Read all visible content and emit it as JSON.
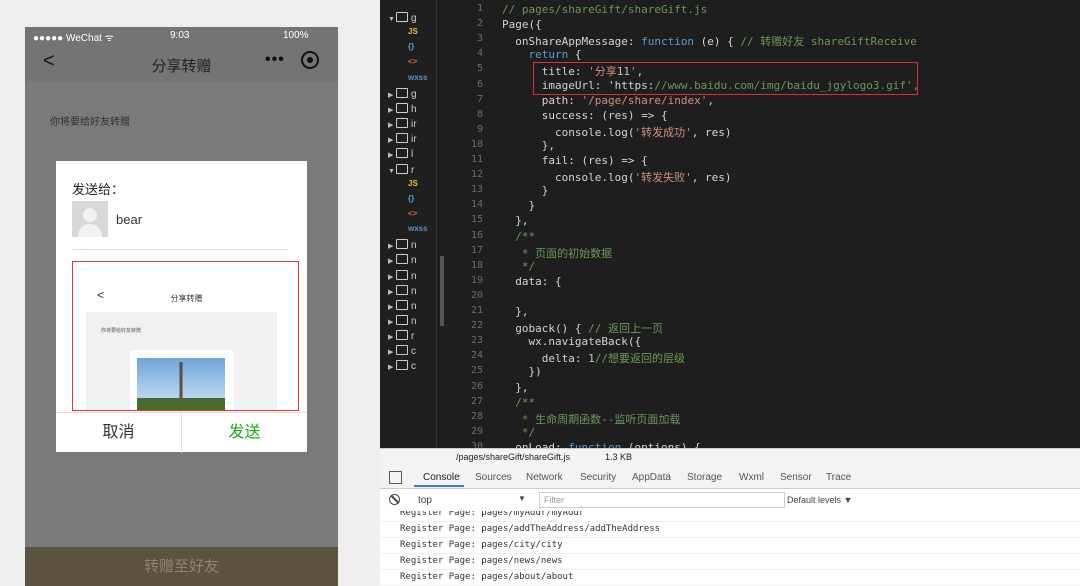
{
  "simulator": {
    "status": {
      "carrier": "●●●●● WeChat ᯤ",
      "time": "9:03",
      "battery": "100%"
    },
    "nav": {
      "back": "<",
      "title": "分享转赠",
      "more": "•••"
    },
    "page_hint": "你将要给好友转赠",
    "bottom_button": "转赠至好友",
    "dialog": {
      "title": "发送给：",
      "user": "bear",
      "preview": {
        "back": "<",
        "title": "分享转赠",
        "hint": "你将要给好友转赠"
      },
      "cancel": "取消",
      "send": "发送"
    }
  },
  "sidebar": {
    "items": [
      {
        "label": "g",
        "type": "folder-open"
      },
      {
        "label": "JS",
        "type": "file-js"
      },
      {
        "label": "{}",
        "type": "file-json"
      },
      {
        "label": "<>",
        "type": "file-wxml"
      },
      {
        "label": "wxss",
        "type": "file-wxss"
      },
      {
        "label": "g",
        "type": "folder"
      },
      {
        "label": "h",
        "type": "folder"
      },
      {
        "label": "ir",
        "type": "folder"
      },
      {
        "label": "ir",
        "type": "folder"
      },
      {
        "label": "l",
        "type": "folder"
      },
      {
        "label": "r",
        "type": "folder-open"
      },
      {
        "label": "JS",
        "type": "file-js"
      },
      {
        "label": "{}",
        "type": "file-json"
      },
      {
        "label": "<>",
        "type": "file-wxml"
      },
      {
        "label": "wxss",
        "type": "file-wxss"
      },
      {
        "label": "n",
        "type": "folder"
      },
      {
        "label": "n",
        "type": "folder"
      },
      {
        "label": "n",
        "type": "folder"
      },
      {
        "label": "n",
        "type": "folder"
      },
      {
        "label": "n",
        "type": "folder"
      },
      {
        "label": "n",
        "type": "folder"
      },
      {
        "label": "r",
        "type": "folder"
      },
      {
        "label": "c",
        "type": "folder"
      },
      {
        "label": "c",
        "type": "folder"
      }
    ]
  },
  "editor": {
    "lines": [
      {
        "n": "1",
        "t": "// pages/shareGift/shareGift.js"
      },
      {
        "n": "2",
        "t": "Page({"
      },
      {
        "n": "3",
        "t": "  onShareAppMessage: function (e) { // 转赠好友 shareGiftReceive"
      },
      {
        "n": "4",
        "t": "    return {"
      },
      {
        "n": "5",
        "t": "      title: '分享11',"
      },
      {
        "n": "6",
        "t": "      imageUrl: 'https://www.baidu.com/img/baidu_jgylogo3.gif',"
      },
      {
        "n": "7",
        "t": "      path: '/page/share/index',"
      },
      {
        "n": "8",
        "t": "      success: (res) => {"
      },
      {
        "n": "9",
        "t": "        console.log('转发成功', res)"
      },
      {
        "n": "10",
        "t": "      },"
      },
      {
        "n": "11",
        "t": "      fail: (res) => {"
      },
      {
        "n": "12",
        "t": "        console.log('转发失败', res)"
      },
      {
        "n": "13",
        "t": "      }"
      },
      {
        "n": "14",
        "t": "    }"
      },
      {
        "n": "15",
        "t": "  },"
      },
      {
        "n": "16",
        "t": "  /**"
      },
      {
        "n": "17",
        "t": "   * 页面的初始数据"
      },
      {
        "n": "18",
        "t": "   */"
      },
      {
        "n": "19",
        "t": "  data: {"
      },
      {
        "n": "20",
        "t": ""
      },
      {
        "n": "21",
        "t": "  },"
      },
      {
        "n": "22",
        "t": "  goback() { // 返回上一页"
      },
      {
        "n": "23",
        "t": "    wx.navigateBack({"
      },
      {
        "n": "24",
        "t": "      delta: 1//想要返回的层级"
      },
      {
        "n": "25",
        "t": "    })"
      },
      {
        "n": "26",
        "t": "  },"
      },
      {
        "n": "27",
        "t": "  /**"
      },
      {
        "n": "28",
        "t": "   * 生命周期函数--监听页面加载"
      },
      {
        "n": "29",
        "t": "   */"
      },
      {
        "n": "30",
        "t": "  onLoad: function (options) {"
      }
    ]
  },
  "filebar": {
    "path": "/pages/shareGift/shareGift.js",
    "size": "1.3 KB"
  },
  "devtools": {
    "tabs": [
      "Console",
      "Sources",
      "Network",
      "Security",
      "AppData",
      "Storage",
      "Wxml",
      "Sensor",
      "Trace"
    ],
    "active_tab": "Console",
    "context": "top",
    "filter_placeholder": "Filter",
    "levels": "Default levels ▼",
    "logs": [
      "Register Page: pages/myAddr/myAddr",
      "Register Page: pages/addTheAddress/addTheAddress",
      "Register Page: pages/city/city",
      "Register Page: pages/news/news",
      "Register Page: pages/about/about"
    ]
  }
}
